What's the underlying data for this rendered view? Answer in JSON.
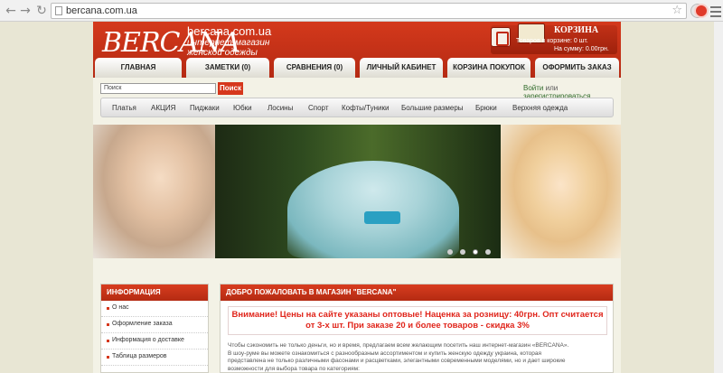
{
  "browser": {
    "url": "bercana.com.ua",
    "back_icon": "arrow-left-icon",
    "forward_icon": "arrow-right-icon",
    "reload_icon": "reload-icon"
  },
  "header": {
    "logo_script": "BERCANA",
    "logo_domain": "bercana.com.ua",
    "logo_line1": "интернет-магазин",
    "logo_line2": "женской одежды",
    "cart_title": "КОРЗИНА",
    "cart_count": "Товаров в корзине: 0 шт.",
    "cart_sum": "На сумму: 0.00грн."
  },
  "tabs": [
    {
      "label": "ГЛАВНАЯ"
    },
    {
      "label": "ЗАМЕТКИ (0)"
    },
    {
      "label": "СРАВНЕНИЯ (0)"
    },
    {
      "label": "ЛИЧНЫЙ КАБИНЕТ"
    },
    {
      "label": "КОРЗИНА ПОКУПОК"
    },
    {
      "label": "ОФОРМИТЬ ЗАКАЗ"
    }
  ],
  "search": {
    "value": "Поиск",
    "button_label": "Поиск",
    "login_label": "Войти",
    "or_label": "или",
    "register_label": "зарегистрироваться"
  },
  "categories": [
    {
      "label": "Платья"
    },
    {
      "label": "АКЦИЯ"
    },
    {
      "label": "Пиджаки"
    },
    {
      "label": "Юбки"
    },
    {
      "label": "Лосины"
    },
    {
      "label": "Спорт"
    },
    {
      "label": "Кофты/Туники"
    },
    {
      "label": "Большие размеры"
    },
    {
      "label": "Брюки"
    },
    {
      "label": "Верхняя одежда"
    }
  ],
  "sidebar": {
    "title": "ИНФОРМАЦИЯ",
    "items": [
      {
        "label": "О нас"
      },
      {
        "label": "Оформление заказа"
      },
      {
        "label": "Информация о доставке"
      },
      {
        "label": "Таблица размеров"
      }
    ]
  },
  "main": {
    "title": "ДОБРО ПОЖАЛОВАТЬ В МАГАЗИН \"BERCANA\"",
    "notice_line1": "Внимание! Цены на сайте указаны оптовые! Наценка за розницу: 40грн. Опт считается",
    "notice_line2": "от 3-х шт. При заказе 20 и более товаров - скидка 3%",
    "intro_line1": "Чтобы сэкономить не только деньги, но и время, предлагаем всем желающим посетить наш интернет-магазин «BERCANA».",
    "intro_line2": "В шоу-руме вы можете ознакомиться с разнообразным ассортиментом и купить женскую одежду украина, которая",
    "intro_line3": "представлена не только различными фасонами и расцветками, элегантными современными моделями, но и дает широкие",
    "intro_line4": "возможности для выбора товара по категориям:"
  },
  "colors": {
    "brand_red": "#d6371c",
    "notice_red": "#e0251b",
    "page_bg": "#e8e6d4"
  }
}
